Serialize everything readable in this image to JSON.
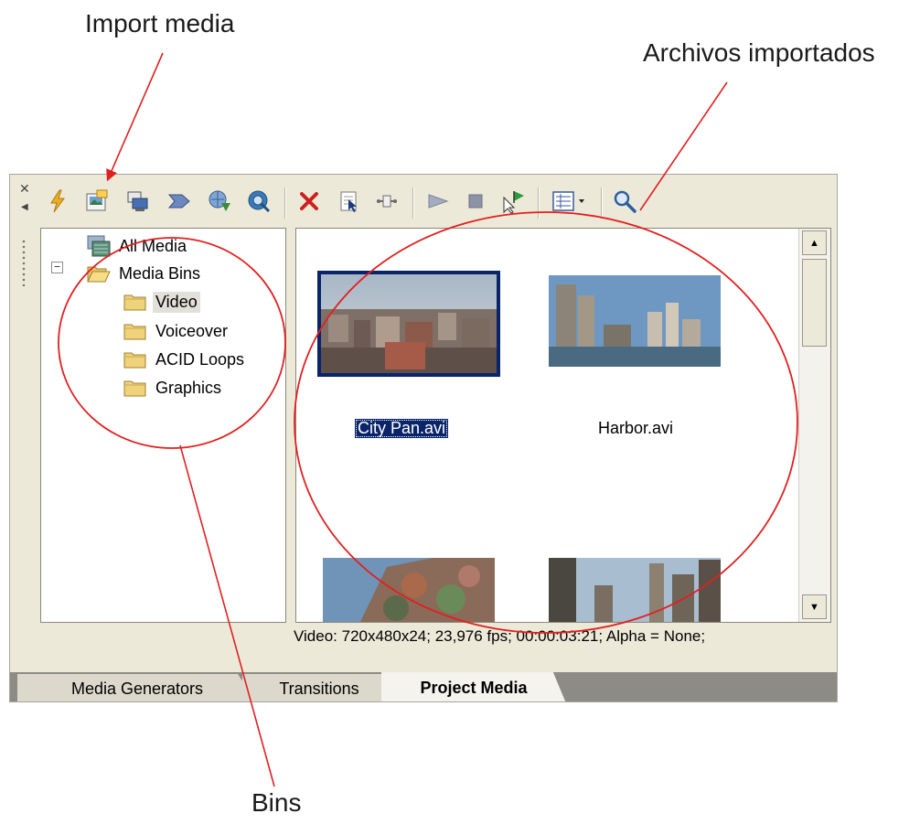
{
  "annotations": {
    "import_media": "Import media",
    "archivos_importados": "Archivos importados",
    "bins": "Bins"
  },
  "toolbar": {
    "buttons": [
      {
        "icon": "lightning-icon",
        "color": "#e8b020"
      },
      {
        "icon": "import-media-icon",
        "color": "#3c6ea8"
      },
      {
        "icon": "capture-video-icon",
        "color": "#4a6fb0"
      },
      {
        "icon": "get-media-icon",
        "color": "#5a7fb8"
      },
      {
        "icon": "web-media-icon",
        "color": "#3b8a3b"
      },
      {
        "icon": "search-media-icon",
        "color": "#2f6fa8"
      },
      {
        "icon": "delete-icon",
        "color": "#cc2020"
      },
      {
        "icon": "select-unused-icon",
        "color": "#2050a0"
      },
      {
        "icon": "properties-icon",
        "color": "#6a6a6a"
      },
      {
        "icon": "play-icon",
        "color": "#9aa3b5"
      },
      {
        "icon": "stop-icon",
        "color": "#8c93a6"
      },
      {
        "icon": "auto-preview-icon",
        "color": "#2a9a3a"
      },
      {
        "icon": "views-icon",
        "color": "#3a5a9a"
      },
      {
        "icon": "zoom-icon",
        "color": "#2f5f9f"
      }
    ]
  },
  "tree": {
    "all_media": "All Media",
    "media_bins": "Media Bins",
    "expander": "−",
    "bins": [
      {
        "label": "Video",
        "selected": true
      },
      {
        "label": "Voiceover",
        "selected": false
      },
      {
        "label": "ACID Loops",
        "selected": false
      },
      {
        "label": "Graphics",
        "selected": false
      }
    ]
  },
  "files": [
    {
      "name": "City Pan.avi",
      "selected": true
    },
    {
      "name": "Harbor.avi",
      "selected": false
    }
  ],
  "status": "Video: 720x480x24; 23,976 fps; 00:00:03:21; Alpha = None;",
  "tabs": [
    {
      "label": "Media Generators",
      "active": false
    },
    {
      "label": "Transitions",
      "active": false
    },
    {
      "label": "Project Media",
      "active": true
    }
  ],
  "colors": {
    "selection": "#0a246a",
    "annotation": "#e02020",
    "panel_bg": "#ece9d8"
  }
}
